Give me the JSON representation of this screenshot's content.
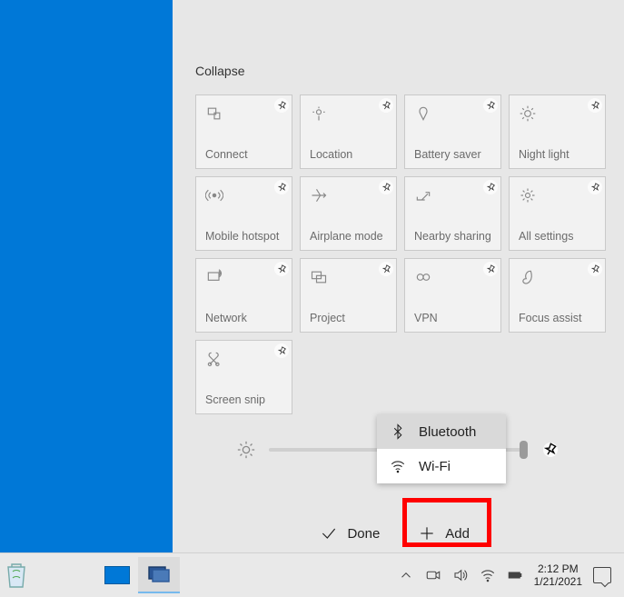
{
  "action_center": {
    "collapse_label": "Collapse",
    "tiles": [
      {
        "label": "Connect",
        "icon": "connect"
      },
      {
        "label": "Location",
        "icon": "location"
      },
      {
        "label": "Battery saver",
        "icon": "battery"
      },
      {
        "label": "Night light",
        "icon": "nightlight"
      },
      {
        "label": "Mobile hotspot",
        "icon": "hotspot"
      },
      {
        "label": "Airplane mode",
        "icon": "airplane"
      },
      {
        "label": "Nearby sharing",
        "icon": "nearby"
      },
      {
        "label": "All settings",
        "icon": "settings"
      },
      {
        "label": "Network",
        "icon": "network"
      },
      {
        "label": "Project",
        "icon": "project"
      },
      {
        "label": "VPN",
        "icon": "vpn"
      },
      {
        "label": "Focus assist",
        "icon": "focus"
      },
      {
        "label": "Screen snip",
        "icon": "snip"
      }
    ],
    "done_label": "Done",
    "add_label": "Add"
  },
  "popup": {
    "items": [
      {
        "label": "Bluetooth",
        "icon": "bluetooth",
        "selected": true
      },
      {
        "label": "Wi-Fi",
        "icon": "wifi",
        "selected": false
      }
    ]
  },
  "taskbar": {
    "time": "2:12 PM",
    "date": "1/21/2021"
  }
}
